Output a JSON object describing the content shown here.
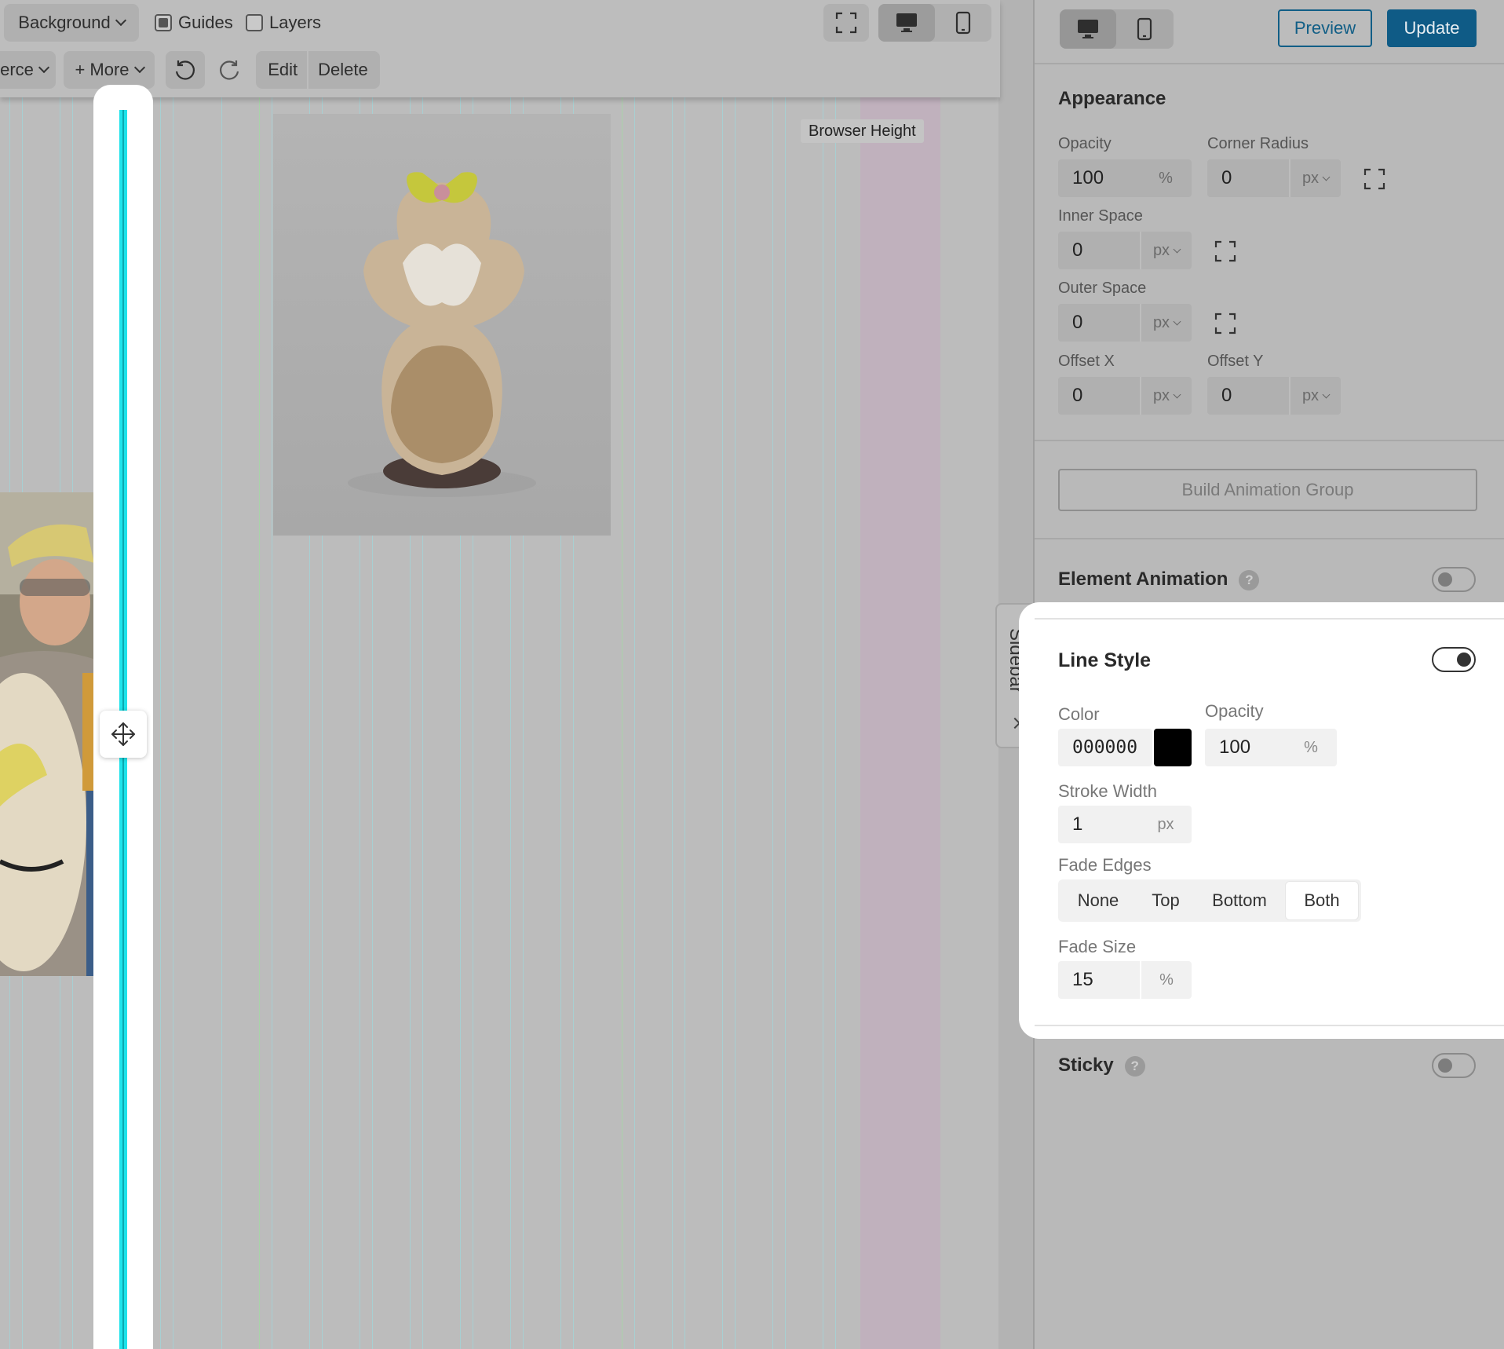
{
  "toolbar": {
    "background_label": "Background",
    "guides_label": "Guides",
    "guides_checked": true,
    "layers_label": "Layers",
    "layers_checked": false,
    "commerce_label": "erce",
    "more_label": "+ More",
    "edit_label": "Edit",
    "delete_label": "Delete"
  },
  "canvas": {
    "browser_height_label": "Browser Height",
    "sidebar_tab_label": "Sidebar"
  },
  "panel": {
    "preview_label": "Preview",
    "update_label": "Update",
    "appearance": {
      "title": "Appearance",
      "opacity_label": "Opacity",
      "opacity_value": "100",
      "opacity_unit": "%",
      "corner_radius_label": "Corner Radius",
      "corner_radius_value": "0",
      "corner_radius_unit": "px",
      "inner_space_label": "Inner Space",
      "inner_space_value": "0",
      "inner_space_unit": "px",
      "outer_space_label": "Outer Space",
      "outer_space_value": "0",
      "outer_space_unit": "px",
      "offset_x_label": "Offset X",
      "offset_x_value": "0",
      "offset_x_unit": "px",
      "offset_y_label": "Offset Y",
      "offset_y_value": "0",
      "offset_y_unit": "px"
    },
    "build_animation_group_label": "Build Animation Group",
    "element_animation": {
      "title": "Element Animation",
      "help": "?",
      "enabled": false
    },
    "line_style": {
      "title": "Line Style",
      "enabled": true,
      "color_label": "Color",
      "color_value": "000000",
      "color_swatch": "#000000",
      "opacity_label": "Opacity",
      "opacity_value": "100",
      "opacity_unit": "%",
      "stroke_width_label": "Stroke Width",
      "stroke_width_value": "1",
      "stroke_width_unit": "px",
      "fade_edges_label": "Fade Edges",
      "fade_edges_options": [
        "None",
        "Top",
        "Bottom",
        "Both"
      ],
      "fade_edges_selected": "Both",
      "fade_size_label": "Fade Size",
      "fade_size_value": "15",
      "fade_size_unit": "%"
    },
    "sticky": {
      "title": "Sticky",
      "help": "?",
      "enabled": false
    }
  },
  "colors": {
    "accent": "#0f5b86",
    "guide_cyan": "#1ee3ea",
    "overlay_gray": "#b9b9b9"
  }
}
